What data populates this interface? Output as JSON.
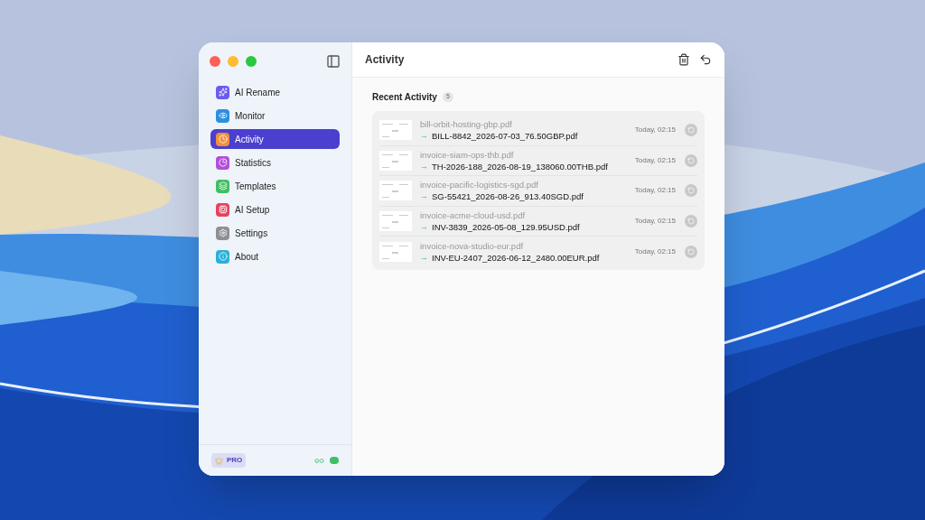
{
  "sidebar": {
    "items": [
      {
        "label": "AI Rename",
        "kind": "sparkle",
        "color": "#6a5cf0",
        "selected": false
      },
      {
        "label": "Monitor",
        "kind": "eye",
        "color": "#2b8fe0",
        "selected": false
      },
      {
        "label": "Activity",
        "kind": "clock",
        "color": "#f0903a",
        "selected": true
      },
      {
        "label": "Statistics",
        "kind": "pie",
        "color": "#b04fd8",
        "selected": false
      },
      {
        "label": "Templates",
        "kind": "layers",
        "color": "#3fbf63",
        "selected": false
      },
      {
        "label": "AI Setup",
        "kind": "chip",
        "color": "#e8415e",
        "selected": false
      },
      {
        "label": "Settings",
        "kind": "gear",
        "color": "#8e8e93",
        "selected": false
      },
      {
        "label": "About",
        "kind": "info",
        "color": "#2ab0d8",
        "selected": false
      }
    ],
    "badge": "PRO"
  },
  "header": {
    "title": "Activity"
  },
  "section": {
    "title": "Recent Activity",
    "count": "5"
  },
  "rows": [
    {
      "original": "bill-orbit-hosting-gbp.pdf",
      "arrow": "→",
      "renamed": "BILL-8842_2026-07-03_76.50GBP.pdf",
      "time": "Today, 02:15"
    },
    {
      "original": "invoice-siam-ops-thb.pdf",
      "arrow": "→",
      "renamed": "TH-2026-188_2026-08-19_138060.00THB.pdf",
      "time": "Today, 02:15"
    },
    {
      "original": "invoice-pacific-logistics-sgd.pdf",
      "arrow": "→",
      "renamed": "SG-55421_2026-08-26_913.40SGD.pdf",
      "time": "Today, 02:15"
    },
    {
      "original": "invoice-acme-cloud-usd.pdf",
      "arrow": "→",
      "renamed": "INV-3839_2026-05-08_129.95USD.pdf",
      "time": "Today, 02:15"
    },
    {
      "original": "invoice-nova-studio-eur.pdf",
      "arrow": "→",
      "renamed": "INV-EU-2407_2026-06-12_2480.00EUR.pdf",
      "time": "Today, 02:15"
    }
  ]
}
